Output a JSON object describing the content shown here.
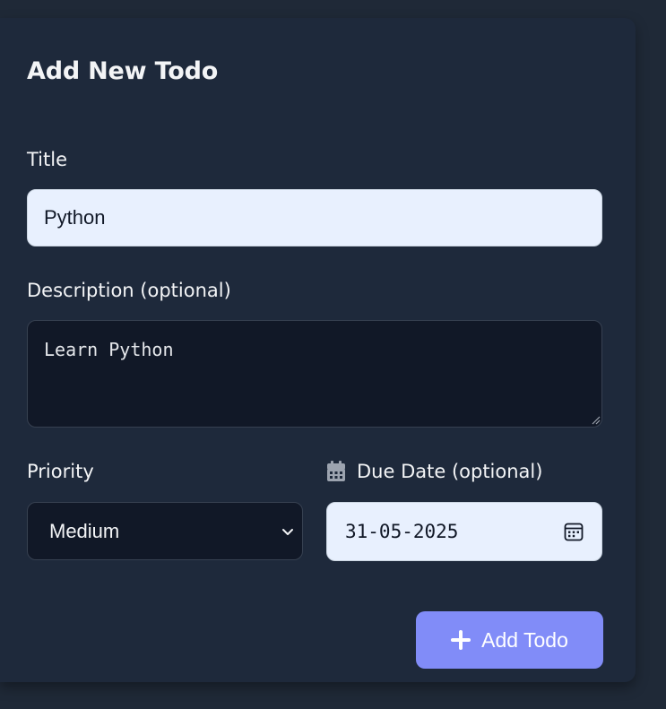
{
  "form": {
    "heading": "Add New Todo",
    "title": {
      "label": "Title",
      "value": "Python"
    },
    "description": {
      "label": "Description (optional)",
      "value": "Learn Python"
    },
    "priority": {
      "label": "Priority",
      "selected": "Medium"
    },
    "due_date": {
      "label": "Due Date (optional)",
      "value": "31-05-2025",
      "icon": "calendar-icon"
    },
    "submit": {
      "label": "Add Todo",
      "icon": "plus-icon"
    }
  },
  "colors": {
    "page_background": "#1f2937",
    "card_background": "#1e293b",
    "input_light": "#e8f0fe",
    "input_dark": "#111827",
    "accent": "#818cf8",
    "text": "#f3f4f6"
  }
}
